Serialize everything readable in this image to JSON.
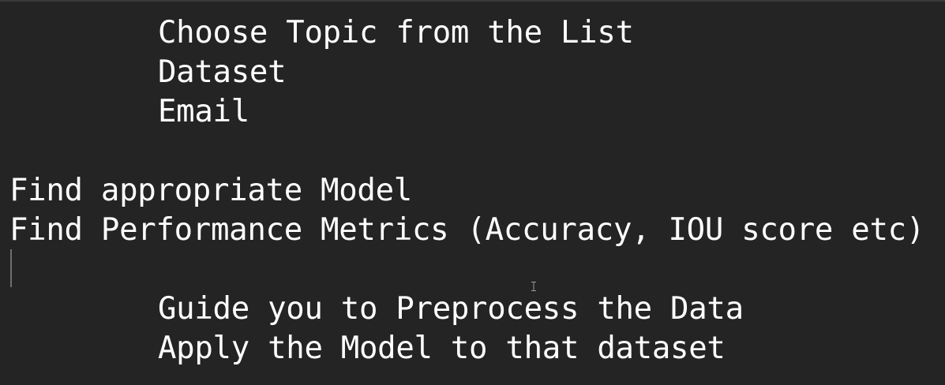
{
  "document": {
    "lines": [
      "Choose Topic from the List",
      "Dataset",
      "Email",
      "",
      "Find appropriate Model",
      "Find Performance Metrics (Accuracy, IOU score etc)",
      "",
      "Guide you to Preprocess the Data",
      "Apply the Model to that dataset"
    ]
  },
  "colors": {
    "background": "#242424",
    "text": "#ffffff",
    "caret": "#6e6e6e"
  }
}
